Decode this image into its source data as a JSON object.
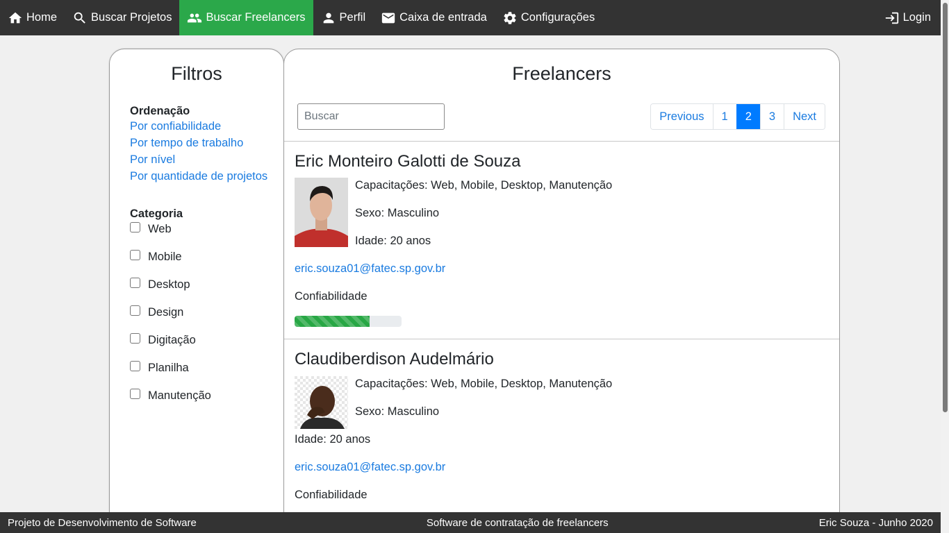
{
  "nav": {
    "items": [
      {
        "label": "Home",
        "icon": "home-icon",
        "active": false
      },
      {
        "label": "Buscar Projetos",
        "icon": "search-icon",
        "active": false
      },
      {
        "label": "Buscar Freelancers",
        "icon": "people-icon",
        "active": true
      },
      {
        "label": "Perfil",
        "icon": "person-icon",
        "active": false
      },
      {
        "label": "Caixa de entrada",
        "icon": "mail-icon",
        "active": false
      },
      {
        "label": "Configurações",
        "icon": "gear-icon",
        "active": false
      }
    ],
    "login_label": "Login",
    "login_icon": "login-icon",
    "bg_color": "#333333",
    "active_color": "#2ba84a"
  },
  "filters": {
    "title": "Filtros",
    "sort_title": "Ordenação",
    "sort_options": [
      "Por confiabilidade",
      "Por tempo de trabalho",
      "Por nível",
      "Por quantidade de projetos"
    ],
    "category_title": "Categoria",
    "categories": [
      {
        "label": "Web",
        "checked": false
      },
      {
        "label": "Mobile",
        "checked": false
      },
      {
        "label": "Desktop",
        "checked": false
      },
      {
        "label": "Design",
        "checked": false
      },
      {
        "label": "Digitação",
        "checked": false
      },
      {
        "label": "Planilha",
        "checked": false
      },
      {
        "label": "Manutenção",
        "checked": false
      }
    ]
  },
  "main": {
    "title": "Freelancers",
    "search_placeholder": "Buscar",
    "pagination": {
      "previous": "Previous",
      "pages": [
        "1",
        "2",
        "3"
      ],
      "current": "2",
      "next": "Next"
    },
    "freelancers": [
      {
        "name": "Eric Monteiro Galotti de Souza",
        "skills": "Capacitações: Web, Mobile, Desktop, Manutenção",
        "sex": "Sexo: Masculino",
        "age": "Idade: 20 anos",
        "email": "eric.souza01@fatec.sp.gov.br",
        "reliability_label": "Confiabilidade",
        "reliability_percent": 70
      },
      {
        "name": "Claudiberdison Audelmário",
        "skills": "Capacitações: Web, Mobile, Desktop, Manutenção",
        "sex": "Sexo: Masculino",
        "age": "Idade: 20 anos",
        "email": "eric.souza01@fatec.sp.gov.br",
        "reliability_label": "Confiabilidade"
      }
    ]
  },
  "footer": {
    "left": "Projeto de Desenvolvimento de Software",
    "center": "Software de contratação de freelancers",
    "right": "Eric Souza - Junho 2020"
  }
}
